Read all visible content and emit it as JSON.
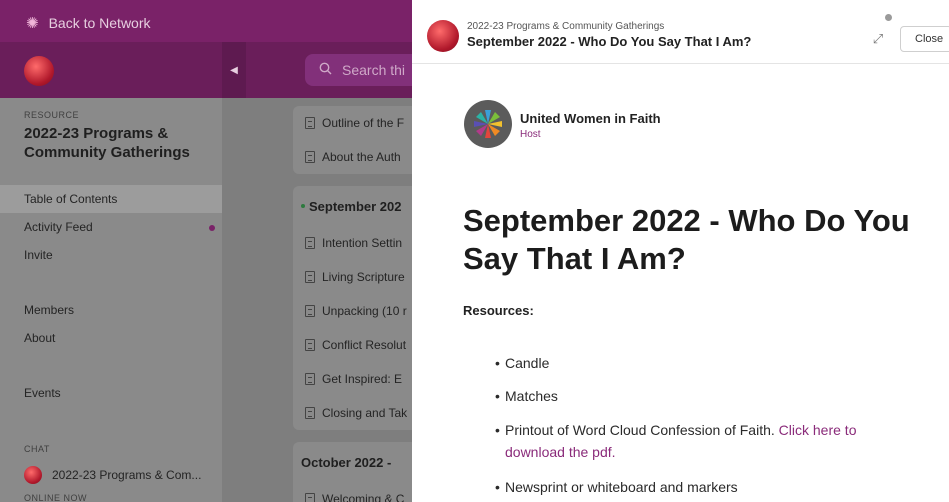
{
  "app": {
    "back_label": "Back to Network",
    "search_placeholder": "Search thi"
  },
  "sidebar": {
    "resource_label": "RESOURCE",
    "resource_title": "2022-23 Programs & Community Gatherings",
    "items": [
      {
        "label": "Table of Contents",
        "active": true
      },
      {
        "label": "Activity Feed",
        "has_dot": true
      },
      {
        "label": "Invite"
      },
      {
        "label": "Members"
      },
      {
        "label": "About"
      },
      {
        "label": "Events"
      }
    ],
    "chat_label": "CHAT",
    "chat_item": "2022-23 Programs & Com...",
    "online_label": "ONLINE NOW"
  },
  "toc": {
    "group1": [
      "Outline of the F",
      "About the Auth"
    ],
    "section_title": "September 202",
    "section_items": [
      "Intention Settin",
      "Living Scripture",
      "Unpacking (10 r",
      "Conflict Resolut",
      "Get Inspired: E",
      "Closing and Tak"
    ],
    "next_section": "October 2022 -",
    "next_item": "Welcoming & C"
  },
  "modal": {
    "breadcrumb": "2022-23 Programs & Community Gatherings",
    "title": "September 2022 - Who Do You Say That I Am?",
    "close_label": "Close",
    "host_name": "United Women in Faith",
    "host_role": "Host",
    "article_title": "September 2022 - Who Do You Say That I Am?",
    "resources_label": "Resources:",
    "resources": [
      "Candle",
      "Matches",
      "Printout of Word Cloud Confession of Faith.",
      "Newsprint or whiteboard and markers"
    ],
    "pdf_link": "Click here to download the pdf."
  },
  "colors": {
    "brand": "#7a2268",
    "link": "#8a2b7a",
    "overlay_gray": "#8a8a8a"
  }
}
